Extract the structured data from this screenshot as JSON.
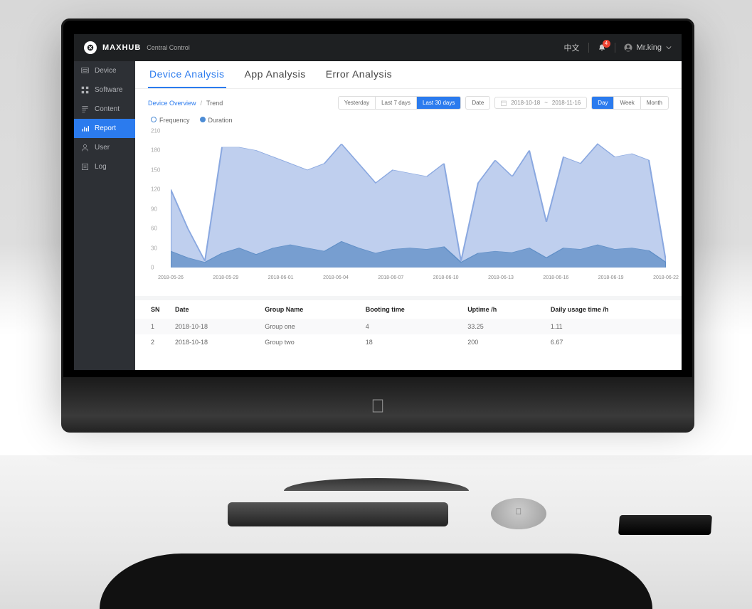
{
  "header": {
    "brand": "MAXHUB",
    "subtitle": "Central Control",
    "lang": "中文",
    "notifications": "4",
    "user": "Mr.king"
  },
  "sidebar": {
    "items": [
      {
        "label": "Device"
      },
      {
        "label": "Software"
      },
      {
        "label": "Content"
      },
      {
        "label": "Report"
      },
      {
        "label": "User"
      },
      {
        "label": "Log"
      }
    ]
  },
  "tabs": [
    "Device Analysis",
    "App Analysis",
    "Error Analysis"
  ],
  "breadcrumb": {
    "root": "Device Overview",
    "current": "Trend"
  },
  "toolbar": {
    "presets": [
      "Yesterday",
      "Last 7 days",
      "Last 30 days"
    ],
    "date_label": "Date",
    "date_from": "2018-10-18",
    "date_to": "2018-11-16",
    "grain": [
      "Day",
      "Week",
      "Month"
    ]
  },
  "chart_data": {
    "type": "area",
    "title": "",
    "xlabel": "",
    "ylabel": "",
    "ylim": [
      0,
      210
    ],
    "yticks": [
      0,
      30,
      60,
      90,
      120,
      150,
      180,
      210
    ],
    "x_tick_labels": [
      "2018-05-26",
      "2018-05-29",
      "2018-06-01",
      "2018-06-04",
      "2018-06-07",
      "2018-06-10",
      "2018-06-13",
      "2018-06-16",
      "2018-06-19",
      "2018-06-22"
    ],
    "x": [
      0,
      1,
      2,
      3,
      4,
      5,
      6,
      7,
      8,
      9,
      10,
      11,
      12,
      13,
      14,
      15,
      16,
      17,
      18,
      19,
      20,
      21,
      22,
      23,
      24,
      25,
      26,
      27,
      28,
      29
    ],
    "series": [
      {
        "name": "Frequency",
        "color": "#8aa8e0",
        "values": [
          120,
          60,
          10,
          185,
          185,
          180,
          170,
          160,
          150,
          160,
          190,
          160,
          130,
          150,
          145,
          140,
          160,
          10,
          130,
          165,
          140,
          180,
          70,
          170,
          160,
          190,
          170,
          175,
          165,
          10
        ]
      },
      {
        "name": "Duration",
        "color": "#5f8ec6",
        "values": [
          25,
          15,
          8,
          22,
          30,
          20,
          30,
          35,
          30,
          25,
          40,
          30,
          22,
          28,
          30,
          28,
          32,
          8,
          22,
          25,
          23,
          30,
          15,
          30,
          28,
          35,
          28,
          30,
          26,
          8
        ]
      }
    ]
  },
  "table": {
    "columns": [
      "SN",
      "Date",
      "Group Name",
      "Booting time",
      "Uptime /h",
      "Daily usage time /h"
    ],
    "rows": [
      [
        "1",
        "2018-10-18",
        "Group one",
        "4",
        "33.25",
        "1.11"
      ],
      [
        "2",
        "2018-10-18",
        "Group two",
        "18",
        "200",
        "6.67"
      ]
    ]
  }
}
